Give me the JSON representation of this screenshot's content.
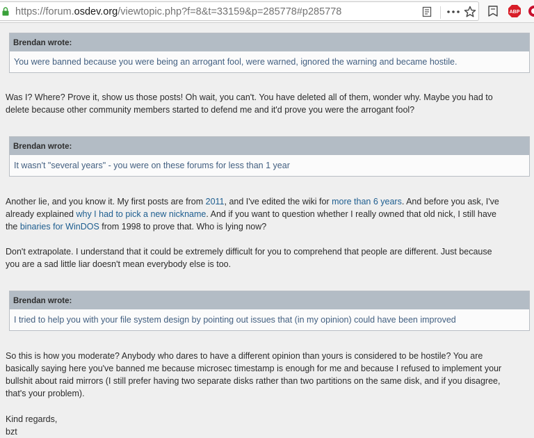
{
  "browser": {
    "url_prefix": "https://forum.",
    "url_domain": "osdev.org",
    "url_rest": "/viewtopic.php?f=8&t=33159&p=285778#p285778",
    "icons": [
      "lock-icon",
      "reader-view-icon",
      "page-actions-menu-icon",
      "bookmark-star-icon",
      "library-icon",
      "adblock-icon",
      "extension-icon"
    ],
    "adblock_label": "ABP",
    "accent_colors": {
      "lock": "#3aa13a",
      "adblock": "#d81e28",
      "link": "#1d5d8f",
      "quote_text": "#425f80"
    }
  },
  "post": {
    "quote1": {
      "author": "Brendan wrote:",
      "text": "You were banned because you were being an arrogant fool, were warned, ignored the warning and became hostile."
    },
    "para1": [
      {
        "t": "Was I? Where? Prove it, show us those posts! Oh wait, you can't. You have deleted all of them, wonder why. Maybe you had to"
      },
      {
        "t": "delete because other community members started to defend me and it'd prove you were the arrogant fool?"
      }
    ],
    "quote2": {
      "author": "Brendan wrote:",
      "text": "It wasn't \"several years\" - you were on these forums for less than 1 year"
    },
    "para2": {
      "l1_a": "Another lie, and you know it. My first posts are from ",
      "link_2011": "2011",
      "l1_b": ", and I've edited the wiki for ",
      "link_6years": "more than 6 years",
      "l1_c": ". And before you ask, I've",
      "l2_a": "already explained ",
      "link_nickname": "why I had to pick a new nickname",
      "l2_b": ". And if you want to question whether I really owned that old nick, I still have",
      "l3_a": "the ",
      "link_binaries": "binaries for WinDOS",
      "l3_b": " from 1998 to prove that. Who is lying now?"
    },
    "para3": [
      {
        "t": "Don't extrapolate. I understand that it could be extremely difficult for you to comprehend that people are different. Just because"
      },
      {
        "t": "you are a sad little liar doesn't mean everybody else is too."
      }
    ],
    "quote3": {
      "author": "Brendan wrote:",
      "text": "I tried to help you with your file system design by pointing out issues that (in my opinion) could have been improved"
    },
    "para4": [
      {
        "t": "So this is how you moderate? Anybody who dares to have a different opinion than yours is considered to be hostile? You are"
      },
      {
        "t": "basically saying here you've banned me because microsec timestamp is enough for me and because I refused to implement your"
      },
      {
        "t": "bullshit about raid mirrors (I still prefer having two separate disks rather than two partitions on the same disk, and if you disagree,"
      },
      {
        "t": "that's your problem)."
      }
    ],
    "signoff": "Kind regards,",
    "signature": "bzt"
  }
}
